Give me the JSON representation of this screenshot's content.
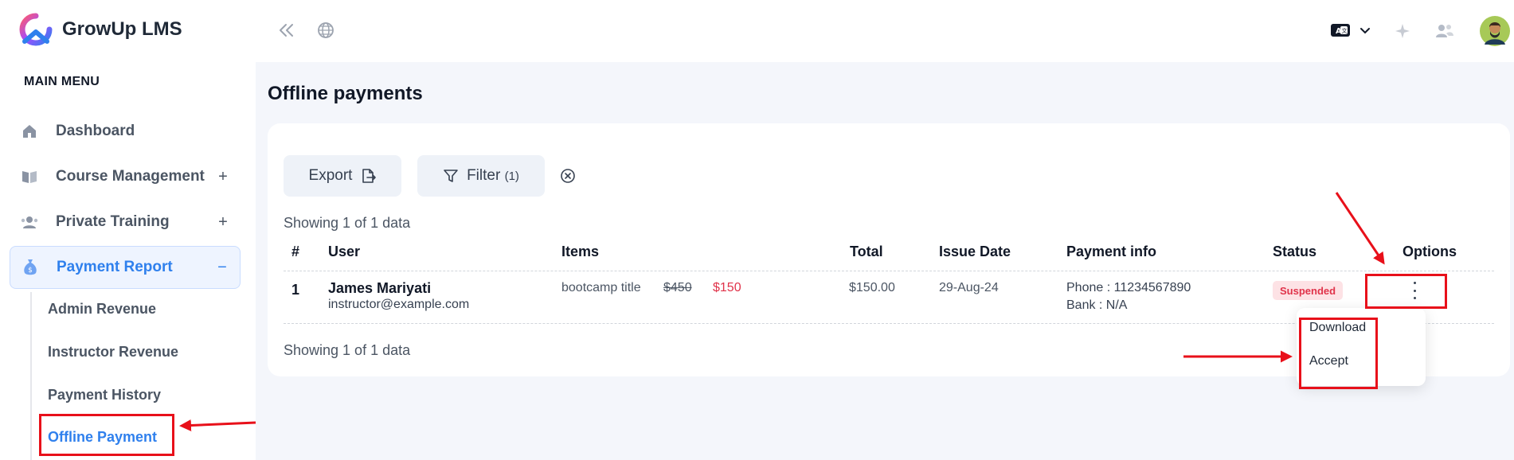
{
  "brand": {
    "name": "GrowUp LMS"
  },
  "sidebar": {
    "heading": "MAIN MENU",
    "items": [
      {
        "label": "Dashboard",
        "icon": "home-icon"
      },
      {
        "label": "Course Management",
        "icon": "book-icon",
        "toggle": "+"
      },
      {
        "label": "Private Training",
        "icon": "users-icon",
        "toggle": "+"
      },
      {
        "label": "Payment Report",
        "icon": "money-bag-icon",
        "toggle": "−"
      }
    ],
    "subitems": [
      {
        "label": "Admin Revenue"
      },
      {
        "label": "Instructor Revenue"
      },
      {
        "label": "Payment History"
      },
      {
        "label": "Offline Payment"
      }
    ]
  },
  "main": {
    "title": "Offline payments",
    "export_label": "Export",
    "filter_label": "Filter",
    "filter_count": "(1)",
    "showing_top": "Showing 1 of 1 data",
    "showing_bottom": "Showing 1 of 1 data",
    "table": {
      "headers": [
        "#",
        "User",
        "Items",
        "Total",
        "Issue Date",
        "Payment info",
        "Status",
        "Options"
      ],
      "rows": [
        {
          "num": "1",
          "user_name": "James Mariyati",
          "user_email": "instructor@example.com",
          "item_title": "bootcamp title",
          "old_price": "$450",
          "new_price": "$150",
          "total": "$150.00",
          "issue_date": "29-Aug-24",
          "phone": "Phone : 11234567890",
          "bank": "Bank : N/A",
          "status": "Suspended"
        }
      ]
    },
    "options_menu": [
      "Download",
      "Accept"
    ]
  },
  "colors": {
    "accent": "#2f80ed",
    "danger": "#e0334a",
    "annotation": "#e8101a"
  }
}
